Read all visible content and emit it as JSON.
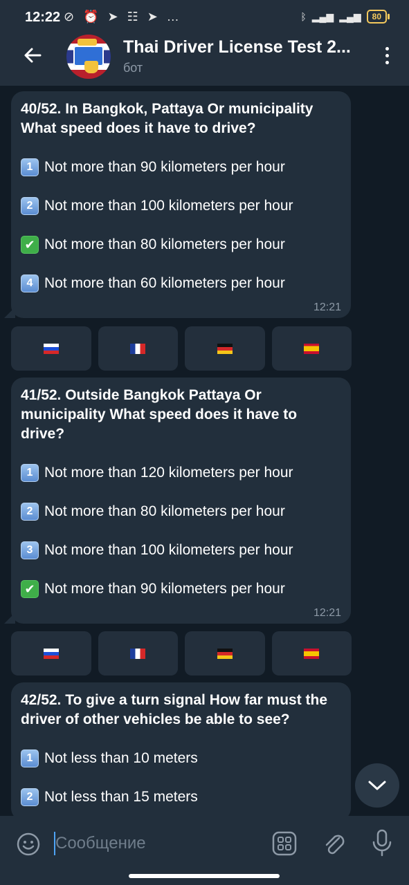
{
  "status": {
    "time": "12:22",
    "icons": "⊘ ⏰ ➤ ☷ ➤ …",
    "battery": "80"
  },
  "header": {
    "title": "Thai Driver License Test 2...",
    "subtitle": "бот"
  },
  "messages": [
    {
      "question": "40/52. In Bangkok, Pattaya Or municipality What speed does it have to drive?",
      "options": [
        {
          "badge": "1",
          "correct": false,
          "text": "Not more than 90 kilometers per hour"
        },
        {
          "badge": "2",
          "correct": false,
          "text": "Not more than 100 kilometers per hour"
        },
        {
          "badge": "✔",
          "correct": true,
          "text": "Not more than 80 kilometers per hour"
        },
        {
          "badge": "4",
          "correct": false,
          "text": "Not more than 60 kilometers per hour"
        }
      ],
      "time": "12:21"
    },
    {
      "question": "41/52. Outside Bangkok Pattaya Or municipality What speed does it have to drive?",
      "options": [
        {
          "badge": "1",
          "correct": false,
          "text": "Not more than 120 kilometers per hour"
        },
        {
          "badge": "2",
          "correct": false,
          "text": "Not more than 80 kilometers per hour"
        },
        {
          "badge": "3",
          "correct": false,
          "text": "Not more than 100 kilometers per hour"
        },
        {
          "badge": "✔",
          "correct": true,
          "text": "Not more than 90 kilometers per hour"
        }
      ],
      "time": "12:21"
    },
    {
      "question": "42/52. To give a turn signal How far must the driver of other vehicles be able to see?",
      "options": [
        {
          "badge": "1",
          "correct": false,
          "text": "Not less than 10 meters"
        },
        {
          "badge": "2",
          "correct": false,
          "text": "Not less than 15 meters"
        }
      ]
    }
  ],
  "keyboard_languages": [
    "ru",
    "fr",
    "de",
    "es"
  ],
  "composer": {
    "placeholder": "Сообщение"
  },
  "colors": {
    "background": "#111b25",
    "bubble": "#222f3c",
    "header": "#232f3c",
    "accent": "#4ea4f6"
  }
}
